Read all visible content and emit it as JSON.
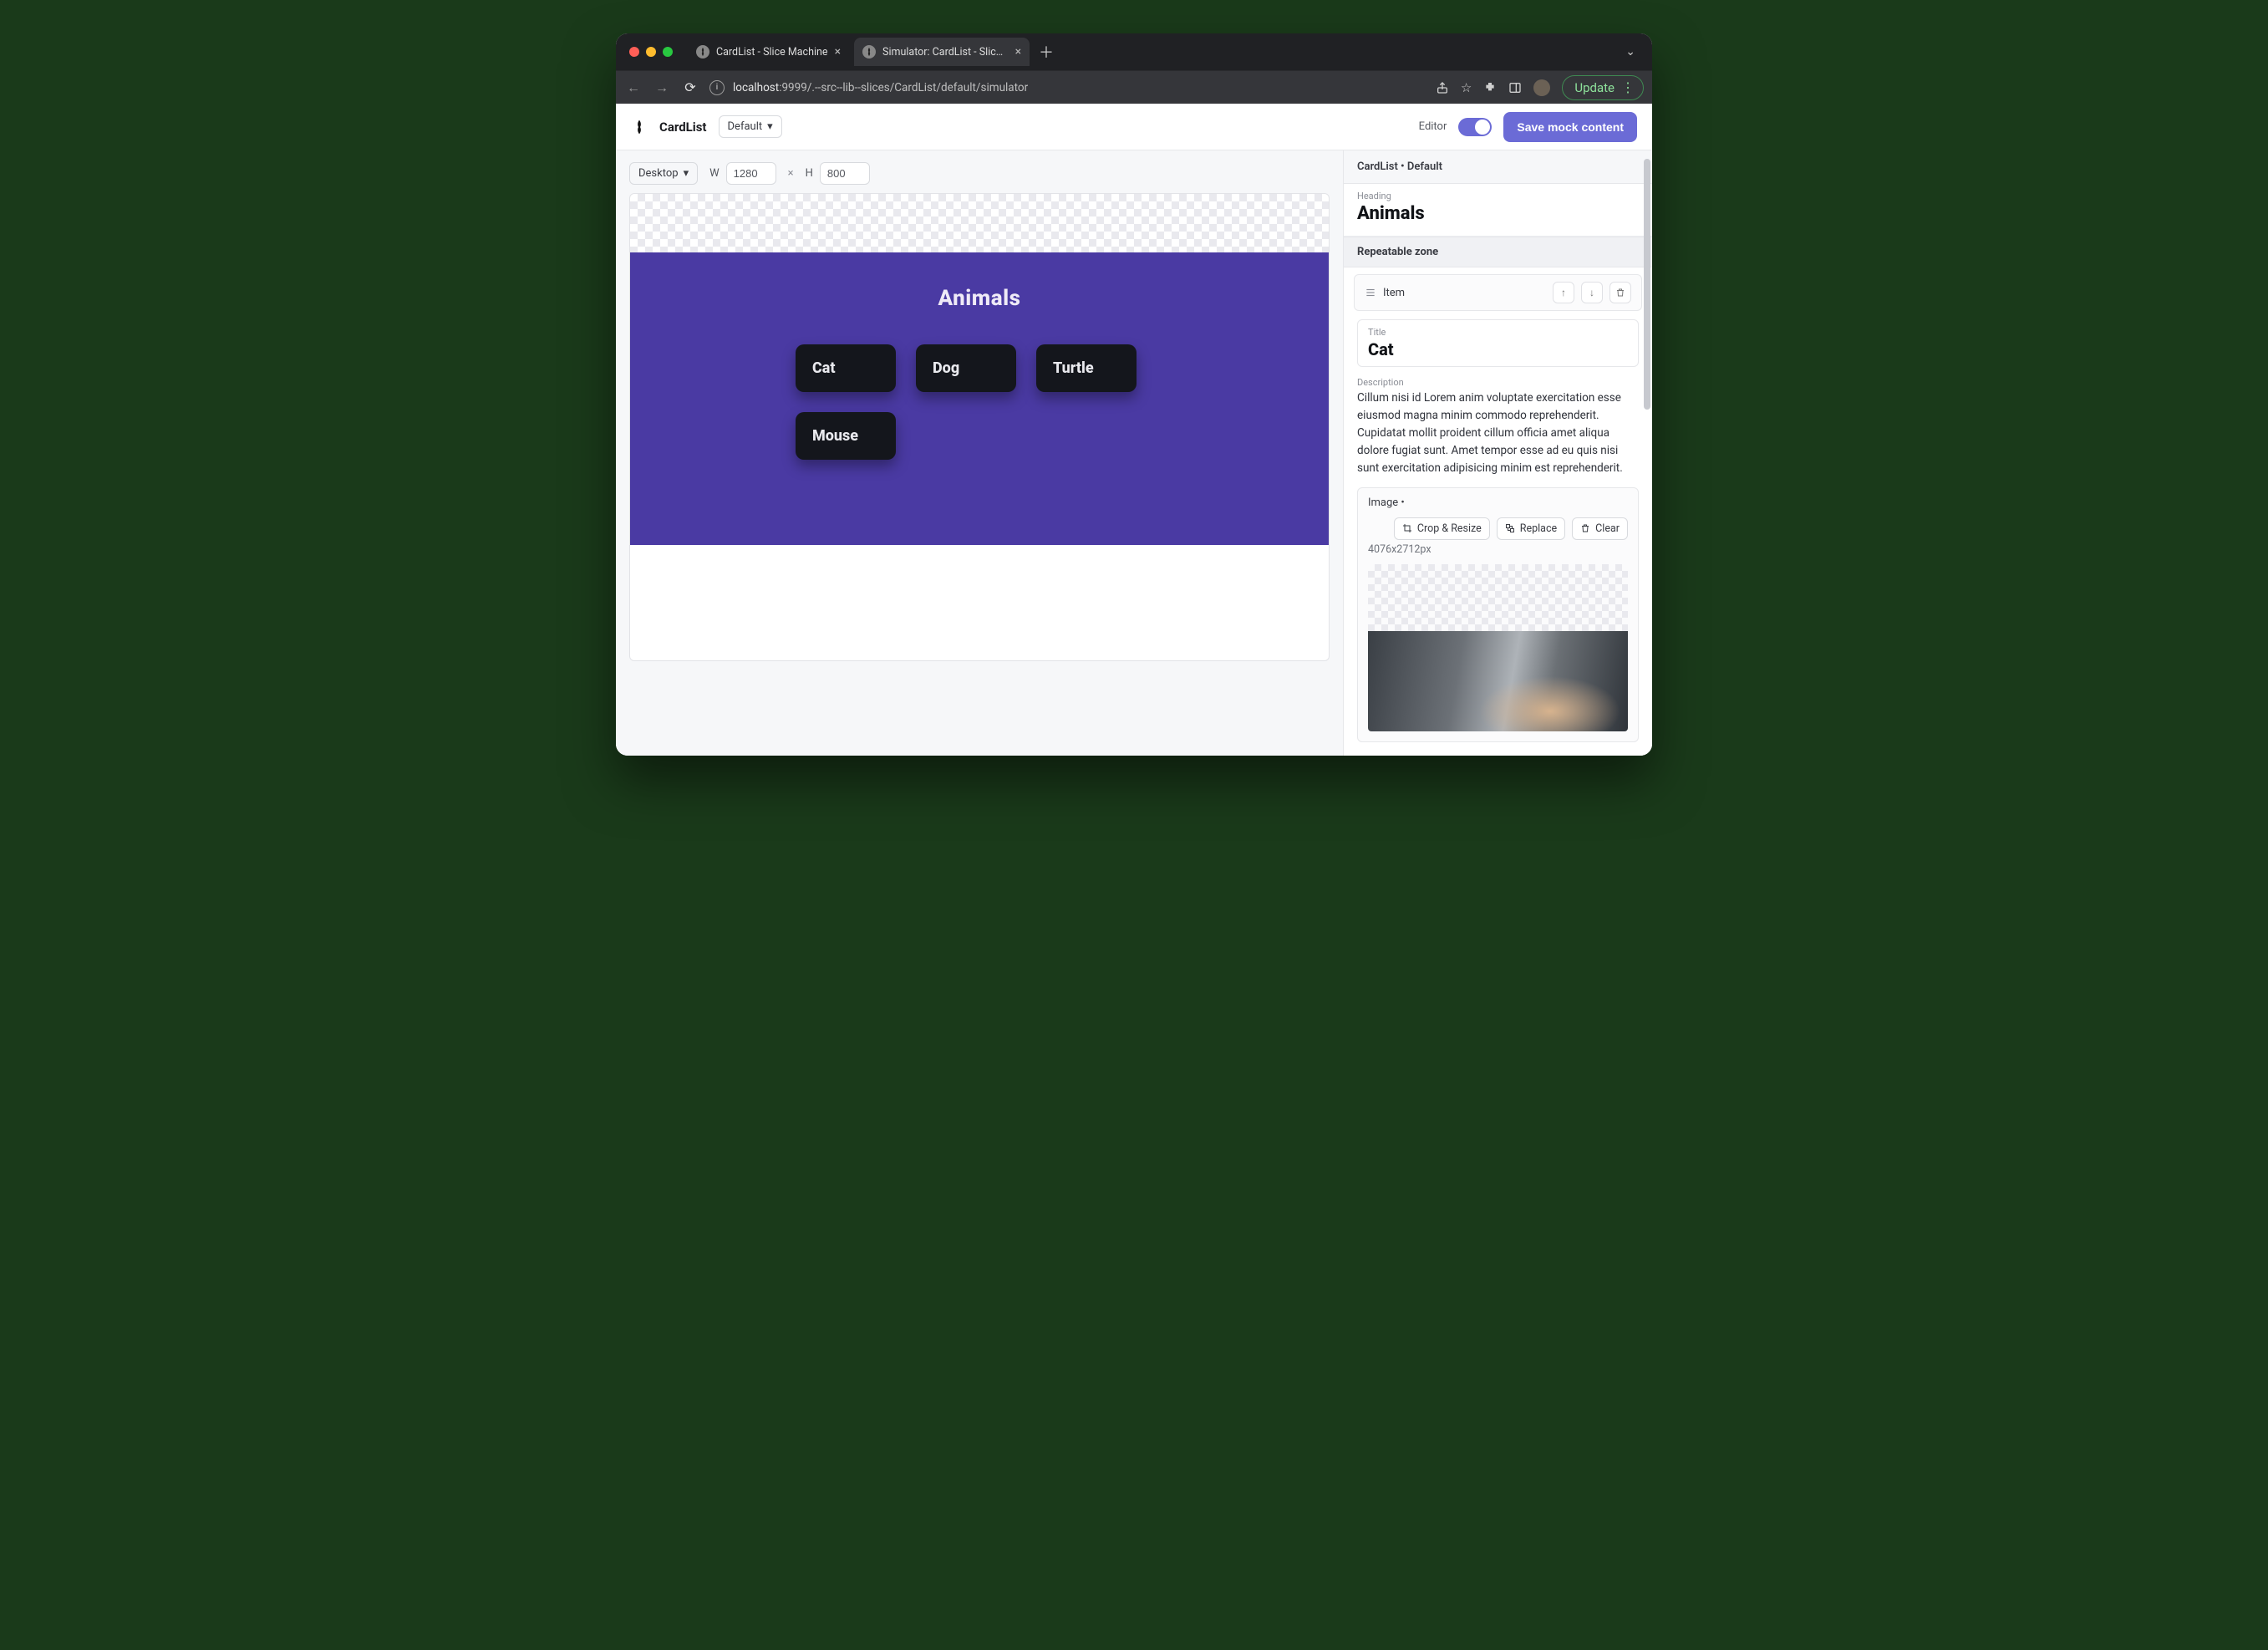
{
  "browser": {
    "tabs": [
      {
        "label": "CardList - Slice Machine",
        "active": false
      },
      {
        "label": "Simulator: CardList - Slice Mac",
        "active": true
      }
    ],
    "url_host": "localhost",
    "url_path": ":9999/.--src--lib--slices/CardList/default/simulator",
    "update_label": "Update"
  },
  "app_header": {
    "brand": "CardList",
    "variant_select": "Default",
    "editor_label": "Editor",
    "editor_on": true,
    "save_button": "Save mock content"
  },
  "dimensions": {
    "device_select": "Desktop",
    "w_label": "W",
    "w_value": "1280",
    "times": "×",
    "h_label": "H",
    "h_value": "800"
  },
  "preview": {
    "heading": "Animals",
    "cards": [
      "Cat",
      "Dog",
      "Turtle",
      "Mouse"
    ]
  },
  "sidebar": {
    "breadcrumb": "CardList • Default",
    "heading_label": "Heading",
    "heading_value": "Animals",
    "repeatable_label": "Repeatable zone",
    "item_label": "Item",
    "title_label": "Title",
    "title_value": "Cat",
    "description_label": "Description",
    "description_value": "Cillum nisi id Lorem anim voluptate exercitation esse eiusmod magna minim commodo reprehenderit. Cupidatat mollit proident cillum officia amet aliqua dolore fugiat sunt. Amet tempor esse ad eu quis nisi sunt exercitation adipisicing minim est reprehenderit.",
    "image_label": "Image •",
    "image_dims": "4076x2712px",
    "crop_label": "Crop & Resize",
    "replace_label": "Replace",
    "clear_label": "Clear"
  }
}
